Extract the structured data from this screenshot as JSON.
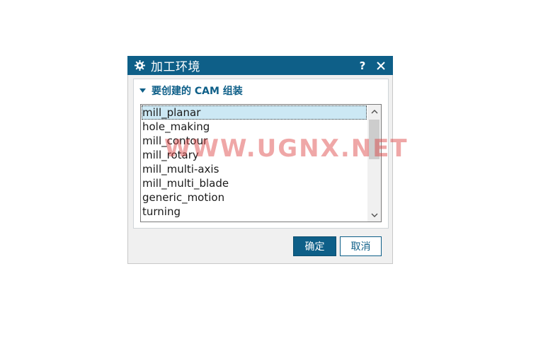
{
  "dialog": {
    "title": "加工环境",
    "help_label": "?",
    "close_label": "✕"
  },
  "group": {
    "header": "要创建的 CAM 组装"
  },
  "list": {
    "items": [
      {
        "label": "mill_planar",
        "selected": true
      },
      {
        "label": "hole_making",
        "selected": false
      },
      {
        "label": "mill_contour",
        "selected": false
      },
      {
        "label": "mill_rotary",
        "selected": false
      },
      {
        "label": "mill_multi-axis",
        "selected": false
      },
      {
        "label": "mill_multi_blade",
        "selected": false
      },
      {
        "label": "generic_motion",
        "selected": false
      },
      {
        "label": "turning",
        "selected": false
      }
    ]
  },
  "buttons": {
    "ok_label": "确定",
    "cancel_label": "取消"
  },
  "watermark": "WWW.UGNX.NET",
  "colors": {
    "accent": "#0e5f88",
    "selection": "#cce8f4"
  }
}
